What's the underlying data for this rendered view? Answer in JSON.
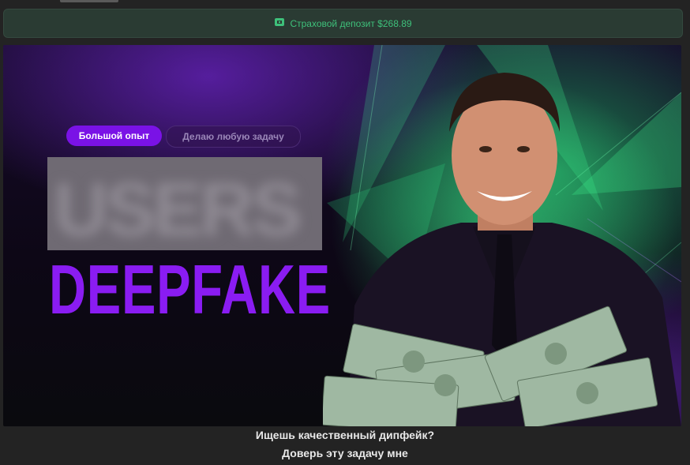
{
  "deposit": {
    "icon": "shield-money-icon",
    "text": "Страховой депозит $268.89",
    "color": "#3ec07a"
  },
  "banner": {
    "tags": [
      "Большой опыт",
      "Делаю любую задачу"
    ],
    "blurred_title": "USERS",
    "headline": "DEEPFAKE",
    "accent": "#8a1cf2",
    "glow": "#24dc78"
  },
  "caption": {
    "line1": "Ищешь качественный дипфейк?",
    "line2": "Доверь эту задачу мне"
  }
}
